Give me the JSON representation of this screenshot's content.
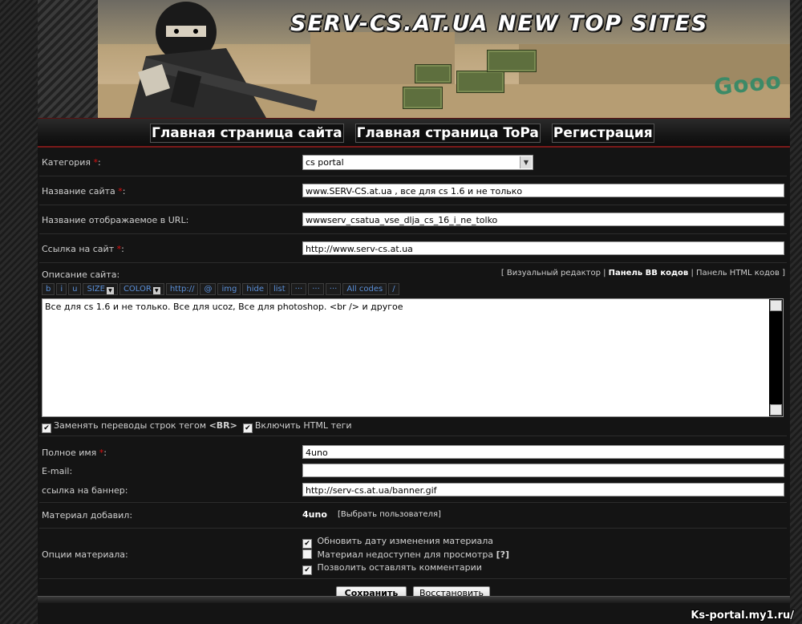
{
  "banner": {
    "title": "SERV-CS.AT.UA NEW TOP SITES",
    "graffiti": "Gooo"
  },
  "nav": {
    "items": [
      "Главная страница сайта",
      "Главная страница ToPa",
      "Регистрация"
    ]
  },
  "form": {
    "category": {
      "label": "Категория",
      "req": "*",
      "colon": ":",
      "value": "cs portal"
    },
    "site_name": {
      "label": "Название сайта",
      "req": "*",
      "colon": ":",
      "value": "www.SERV-CS.at.ua , все для cs 1.6 и не только"
    },
    "url_name": {
      "label": "Название отображаемое в URL:",
      "value": "wwwserv_csatua_vse_dlja_cs_16_i_ne_tolko"
    },
    "link": {
      "label": "Ссылка на сайт",
      "req": "*",
      "colon": ":",
      "value": "http://www.serv-cs.at.ua"
    },
    "description": {
      "label": "Описание сайта:",
      "editor_prefix": "[ ",
      "editor_visual": "Визуальный редактор",
      "sep": " | ",
      "editor_bb": "Панель BB кодов",
      "editor_html": "Панель HTML кодов",
      "editor_suffix": " ]",
      "toolbar": [
        "b",
        "i",
        "u",
        "SIZE",
        "COLOR",
        "http://",
        "@",
        "img",
        "hide",
        "list",
        "···",
        "···",
        "···",
        "All codes",
        "/"
      ],
      "text": "Все для cs 1.6 и не только. Все для ucoz, Все для photoshop. <br /> и другое"
    },
    "options_text": {
      "replace_br_pre": "Заменять переводы строк тегом ",
      "replace_br_tag": "<BR>",
      "enable_html": "Включить HTML теги"
    },
    "full_name": {
      "label": "Полное имя",
      "req": "*",
      "colon": ":",
      "value": "4uno"
    },
    "email": {
      "label": "E-mail:",
      "value": ""
    },
    "banner_link": {
      "label": "ссылка на баннер:",
      "value": "http://serv-cs.at.ua/banner.gif"
    },
    "added_by": {
      "label": "Материал добавил:",
      "value": "4uno",
      "select_user": "[Выбрать пользователя]"
    },
    "material_options": {
      "label": "Опции материала:",
      "items": [
        {
          "text": "Обновить дату изменения материала",
          "checked": true
        },
        {
          "text": "Материал недоступен для просмотра ",
          "help": "[?]",
          "checked": false
        },
        {
          "text": "Позволить оставлять комментарии",
          "checked": true
        }
      ]
    },
    "buttons": {
      "save": "Сохранить",
      "restore": "Восстановить"
    }
  },
  "watermark": "Ks-portal.my1.ru/"
}
